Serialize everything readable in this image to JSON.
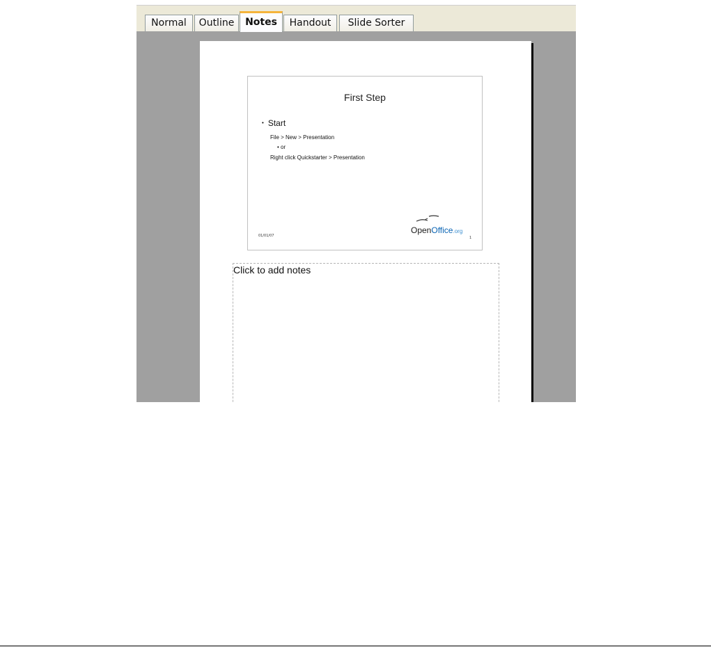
{
  "tabs": [
    {
      "label": "Normal",
      "active": false
    },
    {
      "label": "Outline",
      "active": false
    },
    {
      "label": "Notes",
      "active": true
    },
    {
      "label": "Handout",
      "active": false
    },
    {
      "label": "Slide Sorter",
      "active": false
    }
  ],
  "slide": {
    "title": "First Step",
    "bullet": "Start",
    "bullet_marker": "•",
    "sub_lines": [
      "File > New > Presentation",
      "• or",
      "Right click Quickstarter > Presentation"
    ],
    "date": "01/01/07",
    "number": "1",
    "logo": {
      "open": "Open",
      "office": "Office",
      "org": ".org"
    }
  },
  "notes": {
    "placeholder": "Click to add notes"
  },
  "colors": {
    "tab_active_accent": "#f5b43a",
    "workspace_bg": "#a0a0a0",
    "logo_blue": "#0a64b4"
  }
}
